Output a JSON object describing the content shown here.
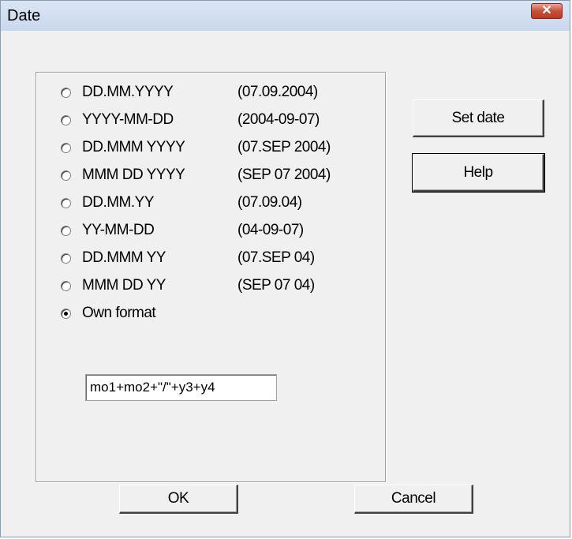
{
  "window": {
    "title": "Date",
    "close_label": "✕"
  },
  "formats": [
    {
      "format": "DD.MM.YYYY",
      "example": "(07.09.2004)",
      "selected": false
    },
    {
      "format": "YYYY-MM-DD",
      "example": "(2004-09-07)",
      "selected": false
    },
    {
      "format": "DD.MMM YYYY",
      "example": "(07.SEP 2004)",
      "selected": false
    },
    {
      "format": "MMM DD YYYY",
      "example": "(SEP 07 2004)",
      "selected": false
    },
    {
      "format": "DD.MM.YY",
      "example": "(07.09.04)",
      "selected": false
    },
    {
      "format": "YY-MM-DD",
      "example": "(04-09-07)",
      "selected": false
    },
    {
      "format": "DD.MMM YY",
      "example": "(07.SEP 04)",
      "selected": false
    },
    {
      "format": "MMM DD YY",
      "example": "(SEP 07 04)",
      "selected": false
    }
  ],
  "own_format": {
    "label": "Own format",
    "selected": true,
    "value": "mo1+mo2+\"/\"+y3+y4"
  },
  "buttons": {
    "set_date": "Set date",
    "help": "Help",
    "ok": "OK",
    "cancel": "Cancel"
  }
}
